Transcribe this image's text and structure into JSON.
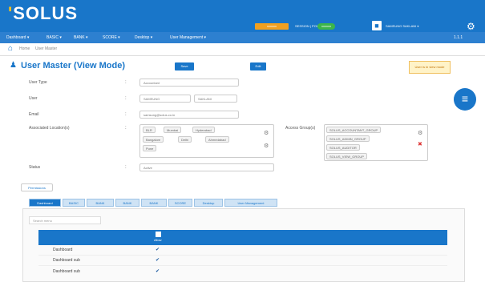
{
  "header": {
    "logo": "SOLUS",
    "badge": "xxxxxx",
    "session_label": "SESSION | POWER |",
    "session_pill": "xxxxxx",
    "user_name": "SAMSUNG SAKLANI ▾"
  },
  "nav": {
    "items": [
      "Dashboard ▾",
      "BASIC ▾",
      "BANK ▾",
      "SCORE ▾",
      "Desktop ▾",
      "User Management ▾"
    ],
    "right": "1.1.1"
  },
  "breadcrumb": {
    "items": [
      "Home",
      "User Master"
    ]
  },
  "page": {
    "title": "User Master (View Mode)",
    "btn_new": "Save",
    "btn_edit": "Edit",
    "warning": "User is in view mode"
  },
  "form": {
    "user_type_label": "User Type",
    "user_type_value": "Accountant",
    "user_label": "User",
    "user_first": "SAMSUNG",
    "user_last": "SAKLANI",
    "email_label": "Email",
    "email_value": "samsung@solus.co.in",
    "assoc_label": "Associated Location(s)",
    "assoc_tags": [
      "BLR",
      "Mumbai",
      "Hyderabad",
      "Bangalore",
      "Delhi",
      "Ahmedabad",
      "Pune"
    ],
    "access_label": "Access Group(s)",
    "access_tags": [
      "SOLUS_ACCOUNTANT_GROUP",
      "SOLUS_ADMIN_GROUP",
      "SOLUS_AUDITOR",
      "SOLUS_VIEW_GROUP"
    ],
    "status_label": "Status",
    "status_value": "Active"
  },
  "actions": {
    "permissions": "Permissions"
  },
  "tabs": [
    "Dashboard",
    "BASIC",
    "BANK",
    "BANK",
    "BANK",
    "SCORE",
    "Desktop",
    "User Management"
  ],
  "table": {
    "filter_placeholder": "Search menu",
    "header": "Allow",
    "rows": [
      "Dashboard",
      "Dashboard sub",
      "Dashboard sub"
    ]
  }
}
